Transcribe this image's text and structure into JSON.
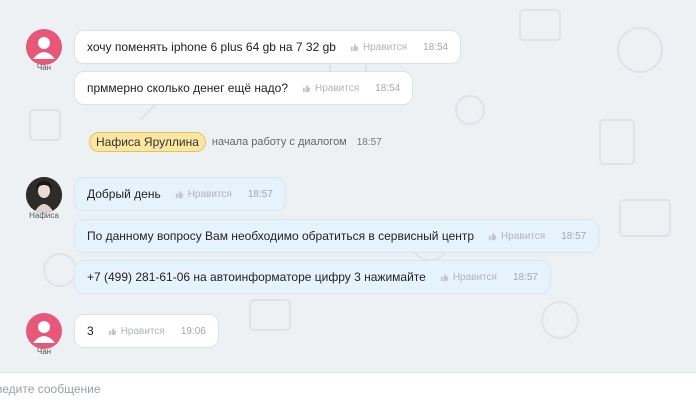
{
  "messages": [
    {
      "text": "хочу поменять iphone 6 plus 64 gb на 7 32 gb",
      "like_label": "Нравится",
      "time": "18:54"
    },
    {
      "text": "прммерно сколько денег ещё надо?",
      "like_label": "Нравится",
      "time": "18:54"
    },
    {
      "text": "Добрый день",
      "like_label": "Нравится",
      "time": "18:57"
    },
    {
      "text": "По данному вопросу Вам необходимо обратиться в сервисный центр",
      "like_label": "Нравится",
      "time": "18:57"
    },
    {
      "text": "+7 (499) 281-61-06 на автоинформаторе цифру 3 нажимайте",
      "like_label": "Нравится",
      "time": "18:57"
    },
    {
      "text": "3",
      "like_label": "Нравится",
      "time": "19:06"
    }
  ],
  "authors": {
    "customer": "Чан",
    "operator": "Нафиса"
  },
  "system_event": {
    "name": "Нафиса Яруллина",
    "text": "начала работу с диалогом",
    "time": "18:57"
  },
  "composer": {
    "placeholder": "Введите сообщение"
  },
  "colors": {
    "customer_avatar": "#e8567a",
    "operator_bubble": "#e7f3fc",
    "name_tag": "#fbe7a1",
    "background": "#eef1f4"
  }
}
